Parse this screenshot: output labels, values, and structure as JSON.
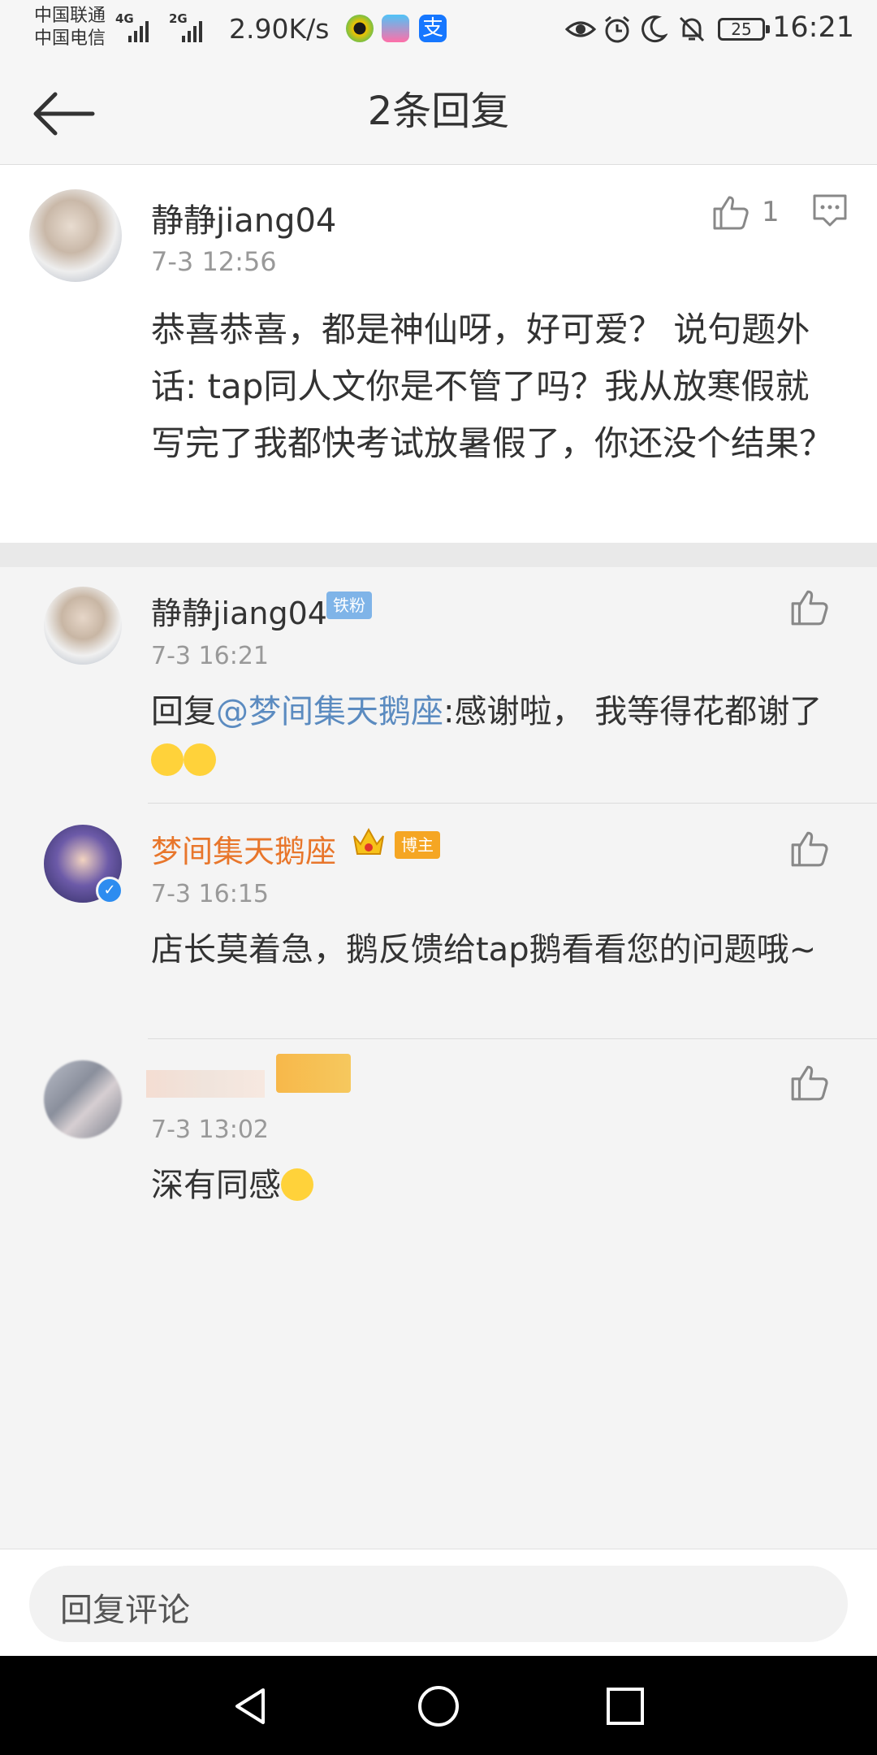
{
  "status_bar": {
    "carrier_1": "中国联通",
    "carrier_2": "中国电信",
    "net_1": "4G",
    "net_2": "2G",
    "speed": "2.90K/s",
    "battery": "25",
    "time": "16:21"
  },
  "header": {
    "title": "2条回复",
    "back_icon": "back-arrow-icon"
  },
  "main_comment": {
    "username": "静静jiang04",
    "time": "7-3 12:56",
    "like_count": "1",
    "text": "恭喜恭喜，都是神仙呀，好可爱？ 说句题外话: tap同人文你是不管了吗？我从放寒假就写完了我都快考试放暑假了，你还没个结果？"
  },
  "replies": [
    {
      "username": "静静jiang04",
      "badge": "铁粉",
      "time": "7-3 16:21",
      "prefix": "回复",
      "mention": "@梦间集天鹅座",
      "text": ":感谢啦， 我等得花都谢了"
    },
    {
      "username": "梦间集天鹅座",
      "badge": "博主",
      "time": "7-3 16:15",
      "text": "店长莫着急，鹅反馈给tap鹅看看您的问题哦~"
    },
    {
      "username": "",
      "time": "7-3 13:02",
      "text": "深有同感"
    }
  ],
  "reply_bar": {
    "placeholder": "回复评论"
  },
  "colors": {
    "mention": "#5b8bc0",
    "vip_name": "#e8762b",
    "fan_badge": "#7fb4e8",
    "blogger_badge": "#f5a623"
  }
}
